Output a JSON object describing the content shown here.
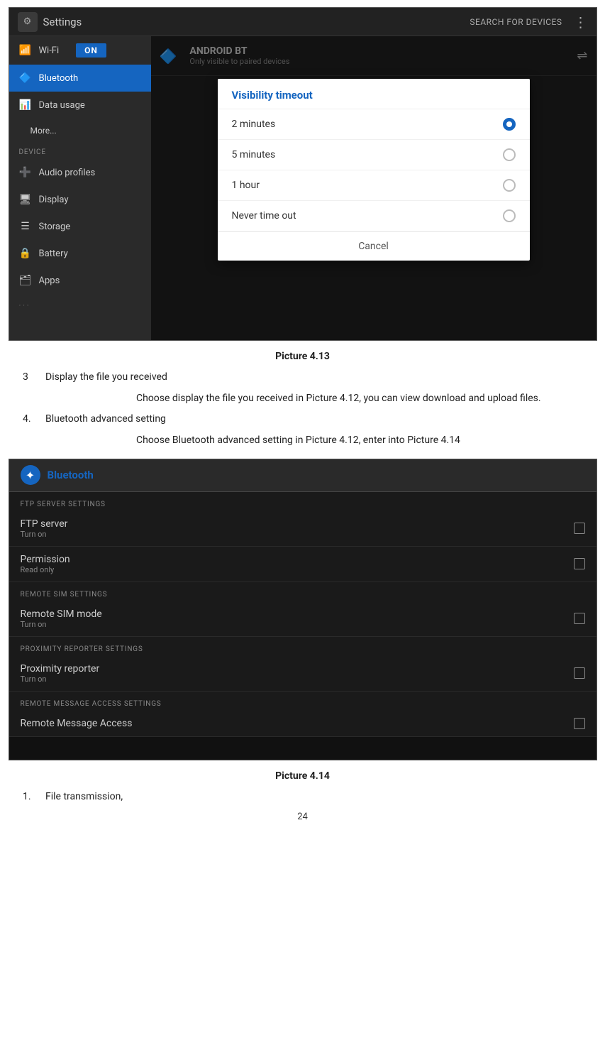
{
  "screenshot1": {
    "topbar": {
      "settings_label": "Settings",
      "search_for_devices": "SEARCH FOR DEVICES"
    },
    "sidebar": {
      "wifi_label": "Wi-Fi",
      "toggle_label": "ON",
      "bluetooth_label": "Bluetooth",
      "data_usage_label": "Data usage",
      "more_label": "More...",
      "device_section": "DEVICE",
      "audio_profiles_label": "Audio profiles",
      "display_label": "Display",
      "storage_label": "Storage",
      "battery_label": "Battery",
      "apps_label": "Apps"
    },
    "bt_header": {
      "android_bt": "ANDROID BT",
      "only_visible": "Only visible to paired devices"
    },
    "dialog": {
      "title": "Visibility timeout",
      "option1": "2 minutes",
      "option2": "5 minutes",
      "option3": "1 hour",
      "option4": "Never time out",
      "cancel": "Cancel"
    }
  },
  "caption1": {
    "text": "Picture 4.13"
  },
  "body": {
    "item3_num": "3",
    "item3_label": "Display the file you received",
    "item3_desc": "Choose display the file you received in Picture 4.12, you can view download and upload files.",
    "item4_num": "4.",
    "item4_label": "Bluetooth advanced setting",
    "item4_desc": "Choose Bluetooth advanced setting in Picture 4.12, enter into Picture 4.14"
  },
  "screenshot2": {
    "header": {
      "title": "Bluetooth"
    },
    "sections": [
      {
        "label": "FTP SERVER SETTINGS",
        "items": [
          {
            "title": "FTP server",
            "sub": "Turn on"
          },
          {
            "title": "Permission",
            "sub": "Read only"
          }
        ]
      },
      {
        "label": "REMOTE SIM SETTINGS",
        "items": [
          {
            "title": "Remote SIM mode",
            "sub": "Turn on"
          }
        ]
      },
      {
        "label": "PROXIMITY REPORTER SETTINGS",
        "items": [
          {
            "title": "Proximity reporter",
            "sub": "Turn on"
          }
        ]
      },
      {
        "label": "REMOTE MESSAGE ACCESS SETTINGS",
        "items": [
          {
            "title": "Remote Message Access",
            "sub": ""
          }
        ]
      }
    ]
  },
  "caption2": {
    "text": "Picture 4.14"
  },
  "footer": {
    "item1_num": "1.",
    "item1_label": "File transmission,",
    "page_number": "24"
  }
}
